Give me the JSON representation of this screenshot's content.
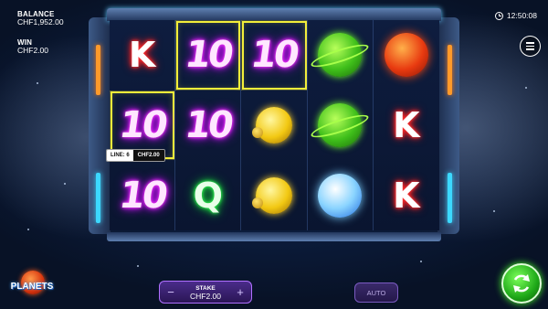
{
  "hud": {
    "balance_label": "BALANCE",
    "balance_value": "CHF1,952.00",
    "win_label": "WIN",
    "win_value": "CHF2.00",
    "clock": "12:50:08"
  },
  "reels": [
    [
      "K",
      "10",
      "10",
      "green-planet",
      "red-planet"
    ],
    [
      "10",
      "10",
      "yellow-planet",
      "green-planet",
      "K"
    ],
    [
      "10",
      "Q",
      "yellow-planet",
      "blue-planet",
      "K"
    ]
  ],
  "winning_cells": [
    "0-1",
    "0-2",
    "1-0"
  ],
  "win_highlight_color": "#f2ee3a",
  "line_tip": {
    "line_label": "LINE: 6",
    "line_value": "CHF2.00"
  },
  "logo": {
    "text": "PLANETS"
  },
  "controls": {
    "stake_label": "STAKE",
    "stake_value": "CHF2.00",
    "minus": "−",
    "plus": "+",
    "auto_label": "AUTO"
  },
  "icons": {
    "clock": "clock-icon",
    "menu": "hamburger-menu-icon",
    "spin": "spin-arrows-icon"
  }
}
